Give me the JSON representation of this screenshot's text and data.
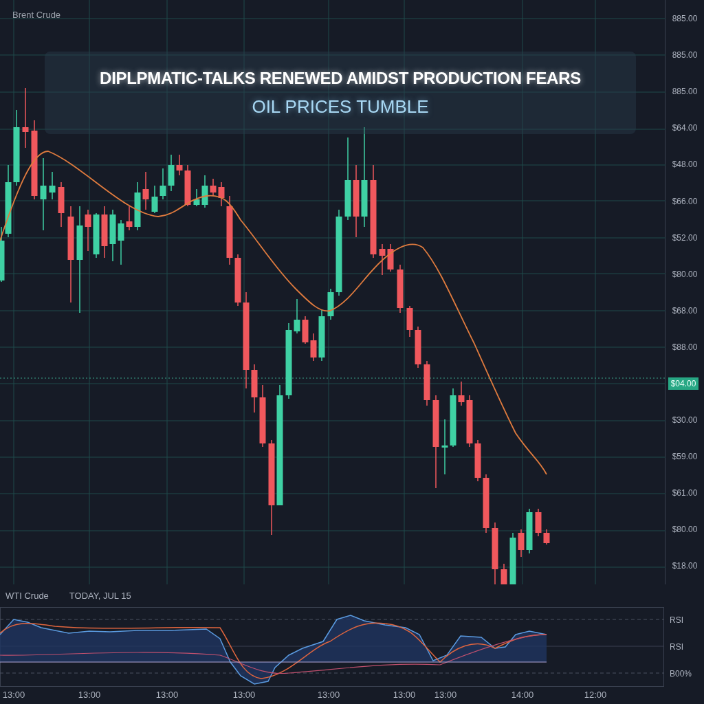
{
  "chart_header": {
    "symbol": "Brent Crude"
  },
  "headline": {
    "title": "DIPLPMATIC-TALKS RENEWED AMIDST PRODUCTION FEARS",
    "subtitle": "OIL PRICES TUMBLE"
  },
  "price_axis": {
    "labels": [
      "885.00",
      "885.00",
      "885.00",
      "$64.00",
      "$48.00",
      "$66.00",
      "$52.00",
      "$80.00",
      "$68.00",
      "$88.00",
      "$30.00",
      "$59.00",
      "$61.00",
      "$80.00",
      "$18.00"
    ],
    "current_price": "$04.00"
  },
  "info_bar": {
    "symbol": "WTI Crude",
    "date": "TODAY, JUL 15"
  },
  "rsi_panel": {
    "labels": [
      "RSI",
      "RSI",
      "B00%"
    ]
  },
  "time_axis": {
    "labels": [
      "13:00",
      "13:00",
      "13:00",
      "13:00",
      "13:00",
      "13:00",
      "13:00",
      "14:00",
      "12:00"
    ]
  }
}
